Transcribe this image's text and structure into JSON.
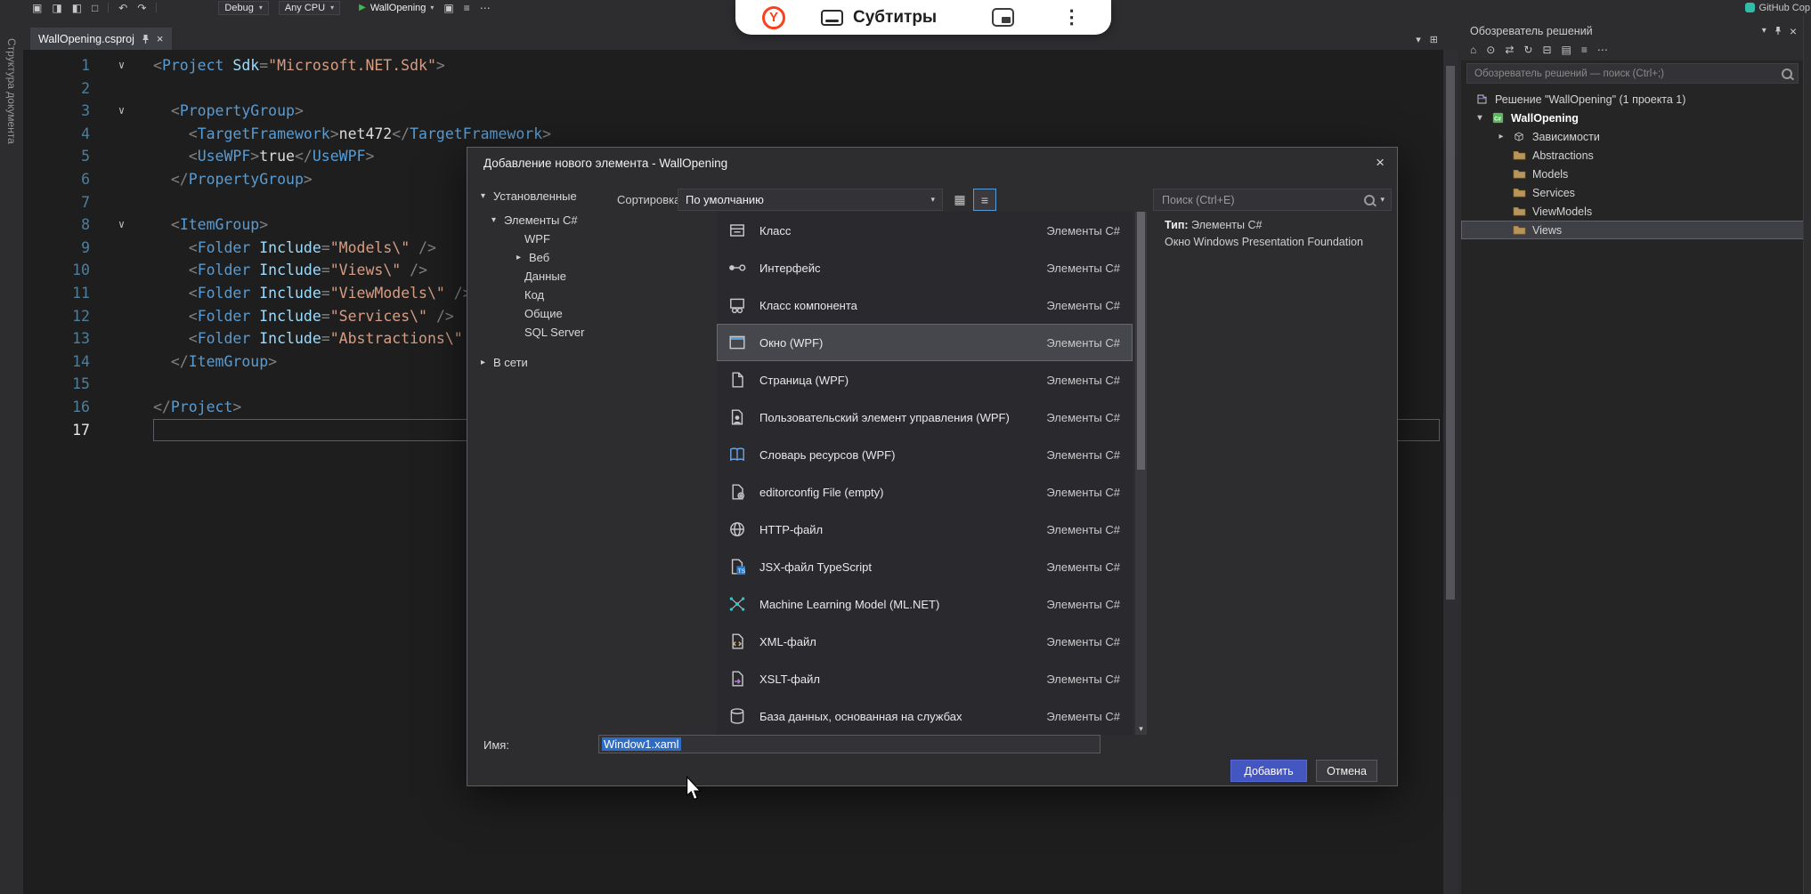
{
  "colors": {
    "editor_bg": "#1e1e1e",
    "chrome_bg": "#2d2d30",
    "accent_button": "#4456c0",
    "selection_highlight": "#2f6cc4",
    "run_green": "#3fb950",
    "tag_blue": "#569cd6",
    "string_orange": "#d69d85"
  },
  "icons": {
    "new-project": "▣",
    "open": "◨",
    "save": "◧",
    "save-all": "□",
    "undo": "↶",
    "redo": "↷",
    "run": "▶",
    "caret": "▾",
    "collapsed": "▸",
    "expanded": "▾",
    "close": "×",
    "editor-split": "⊞",
    "sol-home": "⌂",
    "sol-filter": "⊙",
    "sol-sync": "⇄",
    "sol-refresh": "↻",
    "sol-collapse": "⊟",
    "sol-showall": "▤",
    "sol-viewcode": "≡",
    "sol-more": "⋯",
    "grid-view": "▦",
    "list-view": "≡",
    "scroll-down": "▾",
    "dots-vertical": "⋮",
    "fold": "∨"
  },
  "toolbar": {
    "debug_label": "Debug",
    "platform_label": "Any CPU",
    "run_label": "WallOpening",
    "copilot_label": "GitHub Cop"
  },
  "overlay": {
    "subtitles_label": "Субтитры"
  },
  "editor": {
    "tab_label": "WallOpening.csproj",
    "collapsed_tab_label": "Структура документа",
    "current_line": 17,
    "fold_lines": [
      1,
      3,
      8
    ],
    "lines": [
      [
        [
          "p",
          "<"
        ],
        [
          "t",
          "Project"
        ],
        [
          "x",
          " "
        ],
        [
          "a",
          "Sdk"
        ],
        [
          "p",
          "="
        ],
        [
          "s",
          "\"Microsoft.NET.Sdk\""
        ],
        [
          "p",
          ">"
        ]
      ],
      [],
      [
        [
          "x",
          "  "
        ],
        [
          "p",
          "<"
        ],
        [
          "t",
          "PropertyGroup"
        ],
        [
          "p",
          ">"
        ]
      ],
      [
        [
          "x",
          "    "
        ],
        [
          "p",
          "<"
        ],
        [
          "t",
          "TargetFramework"
        ],
        [
          "p",
          ">"
        ],
        [
          "x",
          "net472"
        ],
        [
          "p",
          "</"
        ],
        [
          "t",
          "TargetFramework"
        ],
        [
          "p",
          ">"
        ]
      ],
      [
        [
          "x",
          "    "
        ],
        [
          "p",
          "<"
        ],
        [
          "t",
          "UseWPF"
        ],
        [
          "p",
          ">"
        ],
        [
          "x",
          "true"
        ],
        [
          "p",
          "</"
        ],
        [
          "t",
          "UseWPF"
        ],
        [
          "p",
          ">"
        ]
      ],
      [
        [
          "x",
          "  "
        ],
        [
          "p",
          "</"
        ],
        [
          "t",
          "PropertyGroup"
        ],
        [
          "p",
          ">"
        ]
      ],
      [],
      [
        [
          "x",
          "  "
        ],
        [
          "p",
          "<"
        ],
        [
          "t",
          "ItemGroup"
        ],
        [
          "p",
          ">"
        ]
      ],
      [
        [
          "x",
          "    "
        ],
        [
          "p",
          "<"
        ],
        [
          "t",
          "Folder"
        ],
        [
          "x",
          " "
        ],
        [
          "a",
          "Include"
        ],
        [
          "p",
          "="
        ],
        [
          "s",
          "\"Models\\\""
        ],
        [
          "x",
          " "
        ],
        [
          "p",
          "/>"
        ]
      ],
      [
        [
          "x",
          "    "
        ],
        [
          "p",
          "<"
        ],
        [
          "t",
          "Folder"
        ],
        [
          "x",
          " "
        ],
        [
          "a",
          "Include"
        ],
        [
          "p",
          "="
        ],
        [
          "s",
          "\"Views\\\""
        ],
        [
          "x",
          " "
        ],
        [
          "p",
          "/>"
        ]
      ],
      [
        [
          "x",
          "    "
        ],
        [
          "p",
          "<"
        ],
        [
          "t",
          "Folder"
        ],
        [
          "x",
          " "
        ],
        [
          "a",
          "Include"
        ],
        [
          "p",
          "="
        ],
        [
          "s",
          "\"ViewModels\\\""
        ],
        [
          "x",
          " "
        ],
        [
          "p",
          "/>"
        ]
      ],
      [
        [
          "x",
          "    "
        ],
        [
          "p",
          "<"
        ],
        [
          "t",
          "Folder"
        ],
        [
          "x",
          " "
        ],
        [
          "a",
          "Include"
        ],
        [
          "p",
          "="
        ],
        [
          "s",
          "\"Services\\\""
        ],
        [
          "x",
          " "
        ],
        [
          "p",
          "/>"
        ]
      ],
      [
        [
          "x",
          "    "
        ],
        [
          "p",
          "<"
        ],
        [
          "t",
          "Folder"
        ],
        [
          "x",
          " "
        ],
        [
          "a",
          "Include"
        ],
        [
          "p",
          "="
        ],
        [
          "s",
          "\"Abstractions\\\""
        ],
        [
          "x",
          " "
        ],
        [
          "p",
          "/>"
        ]
      ],
      [
        [
          "x",
          "  "
        ],
        [
          "p",
          "</"
        ],
        [
          "t",
          "ItemGroup"
        ],
        [
          "p",
          ">"
        ]
      ],
      [],
      [
        [
          "p",
          "</"
        ],
        [
          "t",
          "Project"
        ],
        [
          "p",
          ">"
        ]
      ],
      []
    ]
  },
  "dialog": {
    "title": "Добавление нового элемента - WallOpening",
    "tree": [
      {
        "label": "Установленные"
      },
      {
        "label": "Элементы C#"
      },
      {
        "label": "WPF"
      },
      {
        "label": "Веб"
      },
      {
        "label": "Данные"
      },
      {
        "label": "Код"
      },
      {
        "label": "Общие"
      },
      {
        "label": "SQL Server"
      },
      {
        "label": "В сети"
      }
    ],
    "sort_label": "Сортировка:",
    "sort_value": "По умолчанию",
    "search_placeholder": "Поиск (Ctrl+E)",
    "items": [
      {
        "label": "Класс",
        "category": "Элементы C#"
      },
      {
        "label": "Интерфейс",
        "category": "Элементы C#"
      },
      {
        "label": "Класс компонента",
        "category": "Элементы C#"
      },
      {
        "label": "Окно (WPF)",
        "category": "Элементы C#",
        "selected": true
      },
      {
        "label": "Страница (WPF)",
        "category": "Элементы C#"
      },
      {
        "label": "Пользовательский элемент управления (WPF)",
        "category": "Элементы C#"
      },
      {
        "label": "Словарь ресурсов (WPF)",
        "category": "Элементы C#"
      },
      {
        "label": "editorconfig File (empty)",
        "category": "Элементы C#"
      },
      {
        "label": "HTTP-файл",
        "category": "Элементы C#"
      },
      {
        "label": "JSX-файл TypeScript",
        "category": "Элементы C#"
      },
      {
        "label": "Machine Learning Model (ML.NET)",
        "category": "Элементы C#"
      },
      {
        "label": "XML-файл",
        "category": "Элементы C#"
      },
      {
        "label": "XSLT-файл",
        "category": "Элементы C#"
      },
      {
        "label": "База данных, основанная на службах",
        "category": "Элементы C#"
      }
    ],
    "info_type_label": "Тип:",
    "info_type_value": "Элементы C#",
    "info_desc": "Окно Windows Presentation Foundation",
    "name_label": "Имя:",
    "name_value": "Window1.xaml",
    "add_label": "Добавить",
    "cancel_label": "Отмена"
  },
  "solution_explorer": {
    "title": "Обозреватель решений",
    "search_placeholder": "Обозреватель решений — поиск (Ctrl+;)",
    "tree": [
      {
        "label": "Решение \"WallOpening\" (1 проекта 1)"
      },
      {
        "label": "WallOpening"
      },
      {
        "label": "Зависимости"
      },
      {
        "label": "Abstractions"
      },
      {
        "label": "Models"
      },
      {
        "label": "Services"
      },
      {
        "label": "ViewModels"
      },
      {
        "label": "Views"
      }
    ]
  }
}
